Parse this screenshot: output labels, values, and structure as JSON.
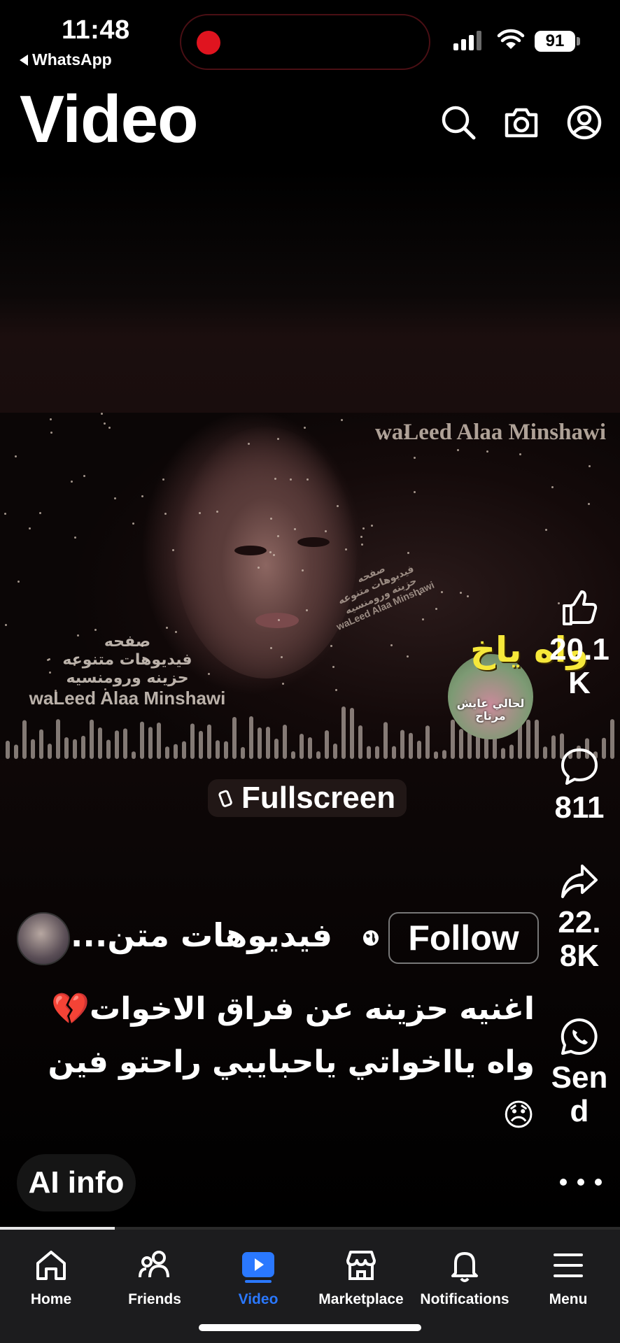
{
  "status_bar": {
    "time": "11:48",
    "back_app": "WhatsApp",
    "battery": "91"
  },
  "header": {
    "title": "Video"
  },
  "video": {
    "watermark_top": "waLeed Alaa Minshawi",
    "stamp_lines": [
      "صفحه",
      "فيديوهات متنوعه",
      "حزينه ورومنسيه",
      "waLeed Alaa Minshawi"
    ],
    "sticker_caption": [
      "لحالي عايش",
      "مرتاح"
    ],
    "overlay_text": "واه ياخ",
    "fullscreen_label": "Fullscreen",
    "progress_fraction": 0.185
  },
  "actions": {
    "like_count": "20.1\nK",
    "comment_count": "811",
    "share_count": "22.\n8K",
    "send_label": "Sen\nd"
  },
  "post": {
    "page_name": "فيديوهات متن...",
    "follow_label": "Follow",
    "caption_line1": "اغنيه حزينه عن فراق الاخوات💔",
    "caption_line2": "واه يااخواتي ياحبايبي راحتو فين 😞",
    "ai_info_label": "AI info"
  },
  "tabbar": {
    "items": [
      {
        "label": "Home",
        "icon": "home-icon"
      },
      {
        "label": "Friends",
        "icon": "friends-icon"
      },
      {
        "label": "Video",
        "icon": "video-icon",
        "active": true
      },
      {
        "label": "Marketplace",
        "icon": "marketplace-icon"
      },
      {
        "label": "Notifications",
        "icon": "bell-icon"
      },
      {
        "label": "Menu",
        "icon": "menu-icon"
      }
    ]
  },
  "colors": {
    "accent": "#2a78ff",
    "record": "#e0141f",
    "overlay_yellow": "#f6e83a"
  }
}
